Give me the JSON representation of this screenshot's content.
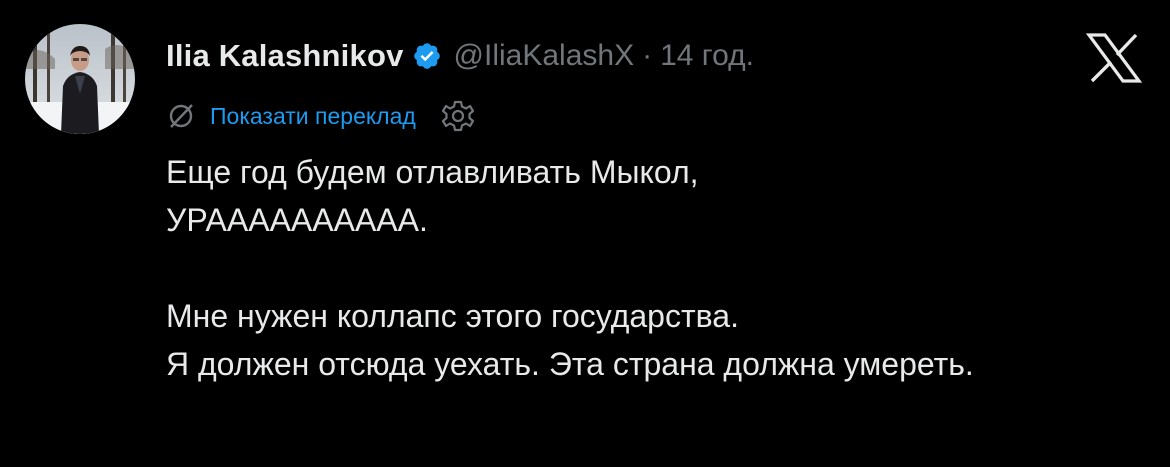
{
  "author": {
    "display_name": "Ilia Kalashnikov",
    "handle": "@IliaKalashX",
    "separator": "·",
    "time": "14 год.",
    "verified": true,
    "avatar_icon": "person-photo-avatar"
  },
  "translate": {
    "icon": "no-translate-icon",
    "label": "Показати переклад",
    "settings_icon": "gear-icon"
  },
  "tweet": {
    "line1": "Еще год будем отлавливать Мыкол,",
    "line2": "УРАААААААААА.",
    "line3": "Мне нужен коллапс этого государства.",
    "line4": "Я должен отсюда уехать. Эта страна должна умереть."
  },
  "brand": {
    "logo": "x-logo-icon"
  },
  "colors": {
    "background": "#000000",
    "text": "#e7e9ea",
    "muted": "#71767b",
    "link": "#1d9bf0",
    "verified": "#1d9bf0"
  }
}
